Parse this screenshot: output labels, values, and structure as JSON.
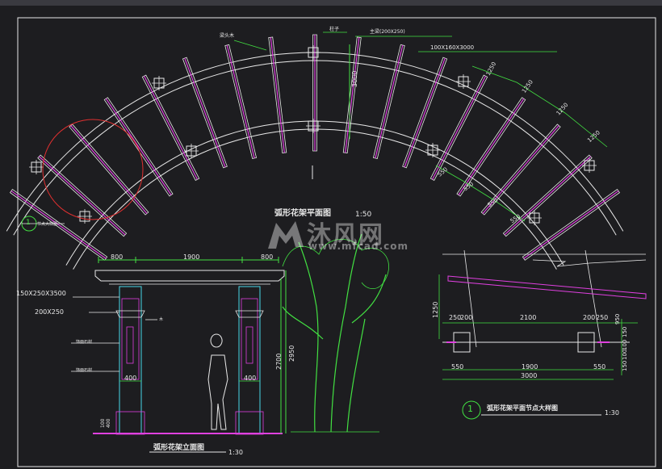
{
  "colors": {
    "bg": "#1d1d20",
    "white": "#e8e8e8",
    "magenta": "#e040e0",
    "cyan": "#48d8e8",
    "green": "#42e042",
    "red": "#e03030"
  },
  "plan": {
    "title": "弧形花架平面图",
    "scale": "1:50",
    "callout_beam": "主梁(200X250)",
    "callout_rafter": "100X160X3000",
    "callout_left": "梁头木",
    "callout_post": "柱子",
    "dim_3000": "3000",
    "dims_outer": [
      "1250",
      "1250",
      "1250",
      "1250"
    ],
    "dims_inner": [
      "550",
      "550",
      "550",
      "550"
    ],
    "detail_marker": "1",
    "detail_marker_label": "节点大样图"
  },
  "elevation": {
    "title": "弧形花架立面图",
    "scale": "1:30",
    "dims_top": [
      "800",
      "1900",
      "800"
    ],
    "label_beam1": "150X250X3500",
    "label_beam2": "200X250",
    "label_cap": "木",
    "label_post1": "饰面石材",
    "label_post2": "饰面石材",
    "dim_400_left": "400",
    "dim_400_right": "400",
    "dim_2700": "2700",
    "dim_2950": "2950",
    "dim_base": "100",
    "dim_base2": "400"
  },
  "detail": {
    "marker": "1",
    "title": "弧形花架平面节点大样图",
    "scale": "1:30",
    "dim_1250": "1250",
    "dims_row1": [
      "250",
      "200",
      "2100",
      "200",
      "250"
    ],
    "dims_row2": [
      "550",
      "1900",
      "550"
    ],
    "dim_total": "3000",
    "dims_right": [
      "950",
      "150",
      "100",
      "100",
      "150"
    ]
  },
  "watermark": {
    "brand": "沐风网",
    "url": "www.mfcad.com"
  }
}
